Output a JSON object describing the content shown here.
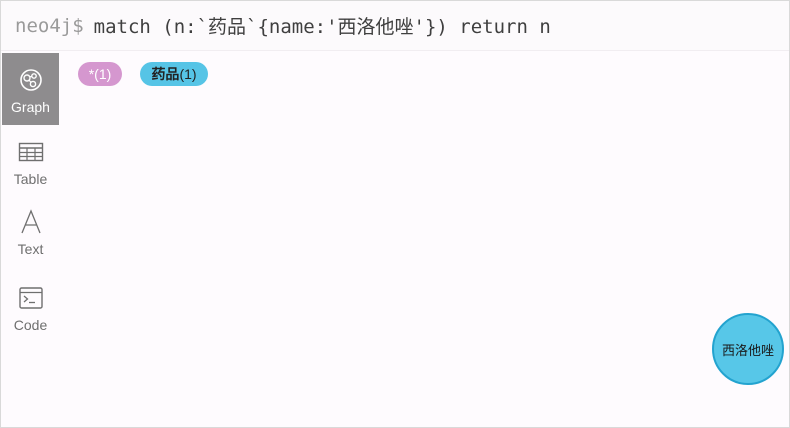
{
  "query_bar": {
    "prompt": "neo4j$",
    "query": "match (n:`药品`{name:'西洛他唑'}) return n"
  },
  "sidebar": {
    "items": [
      {
        "id": "graph",
        "label": "Graph",
        "icon": "graph-icon",
        "active": true
      },
      {
        "id": "table",
        "label": "Table",
        "icon": "table-icon",
        "active": false
      },
      {
        "id": "text",
        "label": "Text",
        "icon": "text-icon",
        "active": false
      },
      {
        "id": "code",
        "label": "Code",
        "icon": "code-icon",
        "active": false
      }
    ]
  },
  "labels": [
    {
      "name": "*",
      "count": "(1)",
      "color": "#d597cf"
    },
    {
      "name": "药品",
      "count": "(1)",
      "color": "#56c4e6"
    }
  ],
  "nodes": [
    {
      "caption": "西洛他唑",
      "color": "#57c7e8",
      "border": "#23a3cf"
    }
  ],
  "colors": {
    "sidebar_active": "#8e8c8e",
    "canvas_bg": "#fefbfe"
  }
}
